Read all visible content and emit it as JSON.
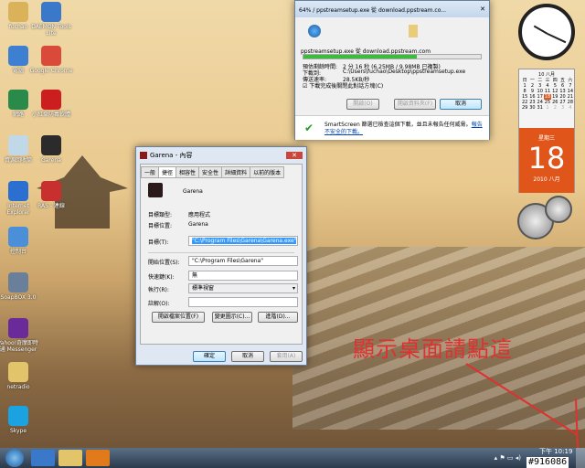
{
  "desktop_icons": [
    {
      "label": "fuchao",
      "color": "#d9b25a"
    },
    {
      "label": "DAEMON Tools Lite",
      "color": "#3a78c9"
    },
    {
      "label": "電腦",
      "color": "#3d7fd1"
    },
    {
      "label": "Google Chrome",
      "color": "#d94a3a"
    },
    {
      "label": "網路",
      "color": "#2a8a4a"
    },
    {
      "label": "小紅傘防毒軟體",
      "color": "#cc1e1e"
    },
    {
      "label": "資源回收筒",
      "color": "#c0d8e8"
    },
    {
      "label": "Garena",
      "color": "#2b2b2b"
    },
    {
      "label": "Internet Explorer",
      "color": "#2b6fd1"
    },
    {
      "label": "RAS - 連線",
      "color": "#c83030"
    },
    {
      "label": "控制台",
      "color": "#4a8fd8"
    },
    {
      "label": "SoapBOX 3.0",
      "color": "#6a7f99"
    },
    {
      "label": "Yahoo!奇摩即時通 Messenger",
      "color": "#6b2a9a"
    },
    {
      "label": "netradio",
      "color": "#e2c56a"
    },
    {
      "label": "Skype",
      "color": "#1aa3e0"
    }
  ],
  "download": {
    "title": "64% / ppstreamsetup.exe 從 download.ppstream.co...",
    "source": "ppstreamsetup.exe 從 download.ppstream.com",
    "progress": 0.64,
    "rows": [
      {
        "k": "預估剩餘時間:",
        "v": "2 分 16 秒 (6.25MB / 9.98MB 已複製)"
      },
      {
        "k": "下載到:",
        "v": "C:\\Users\\fuchao\\Desktop\\ppstreamsetup.exe"
      },
      {
        "k": "傳送速率:",
        "v": "28.5KB/秒"
      }
    ],
    "checkbox": "下載完成後關閉此對話方塊(C)",
    "open": "開啟(O)",
    "open_folder": "開啟資料夾(F)",
    "cancel": "取消",
    "smartscreen": "SmartScreen 篩選已檢查這個下載，並且未報告任何威脅。",
    "report": "報告不安全的下載。"
  },
  "props": {
    "title": "Garena - 內容",
    "tabs": [
      "一般",
      "捷徑",
      "相容性",
      "安全性",
      "詳細資料",
      "以前的版本"
    ],
    "name": "Garena",
    "rows": [
      {
        "k": "目標類型:",
        "v": "應用程式"
      },
      {
        "k": "目標位置:",
        "v": "Garena"
      }
    ],
    "target_label": "目標(T):",
    "target": "\"C:\\Program Files\\Garena\\Garena.exe\"",
    "start_label": "開始位置(S):",
    "start": "\"C:\\Program Files\\Garena\"",
    "hotkey_label": "快速鍵(K):",
    "hotkey": "無",
    "run_label": "執行(R):",
    "run": "標準視窗",
    "comment_label": "註解(O):",
    "btn_open": "開啟檔案位置(F)",
    "btn_icon": "變更圖示(C)...",
    "btn_adv": "進階(D)...",
    "ok": "確定",
    "cancel": "取消",
    "apply": "套用(A)"
  },
  "calendar": {
    "month": "10 八月",
    "weekdays": [
      "日",
      "一",
      "二",
      "三",
      "四",
      "五",
      "六"
    ],
    "days": [
      "1",
      "2",
      "3",
      "4",
      "5",
      "6",
      "7",
      "8",
      "9",
      "10",
      "11",
      "12",
      "13",
      "14",
      "15",
      "16",
      "17",
      "18",
      "19",
      "20",
      "21",
      "22",
      "23",
      "24",
      "25",
      "26",
      "27",
      "28",
      "29",
      "30",
      "31",
      "1",
      "2",
      "3",
      "4"
    ],
    "weekday": "星期三",
    "day": "18",
    "year_month": "2010 八月"
  },
  "annotation": "顯示桌面請點這",
  "clock_text": "下午 10:19",
  "watermark": "#916086"
}
